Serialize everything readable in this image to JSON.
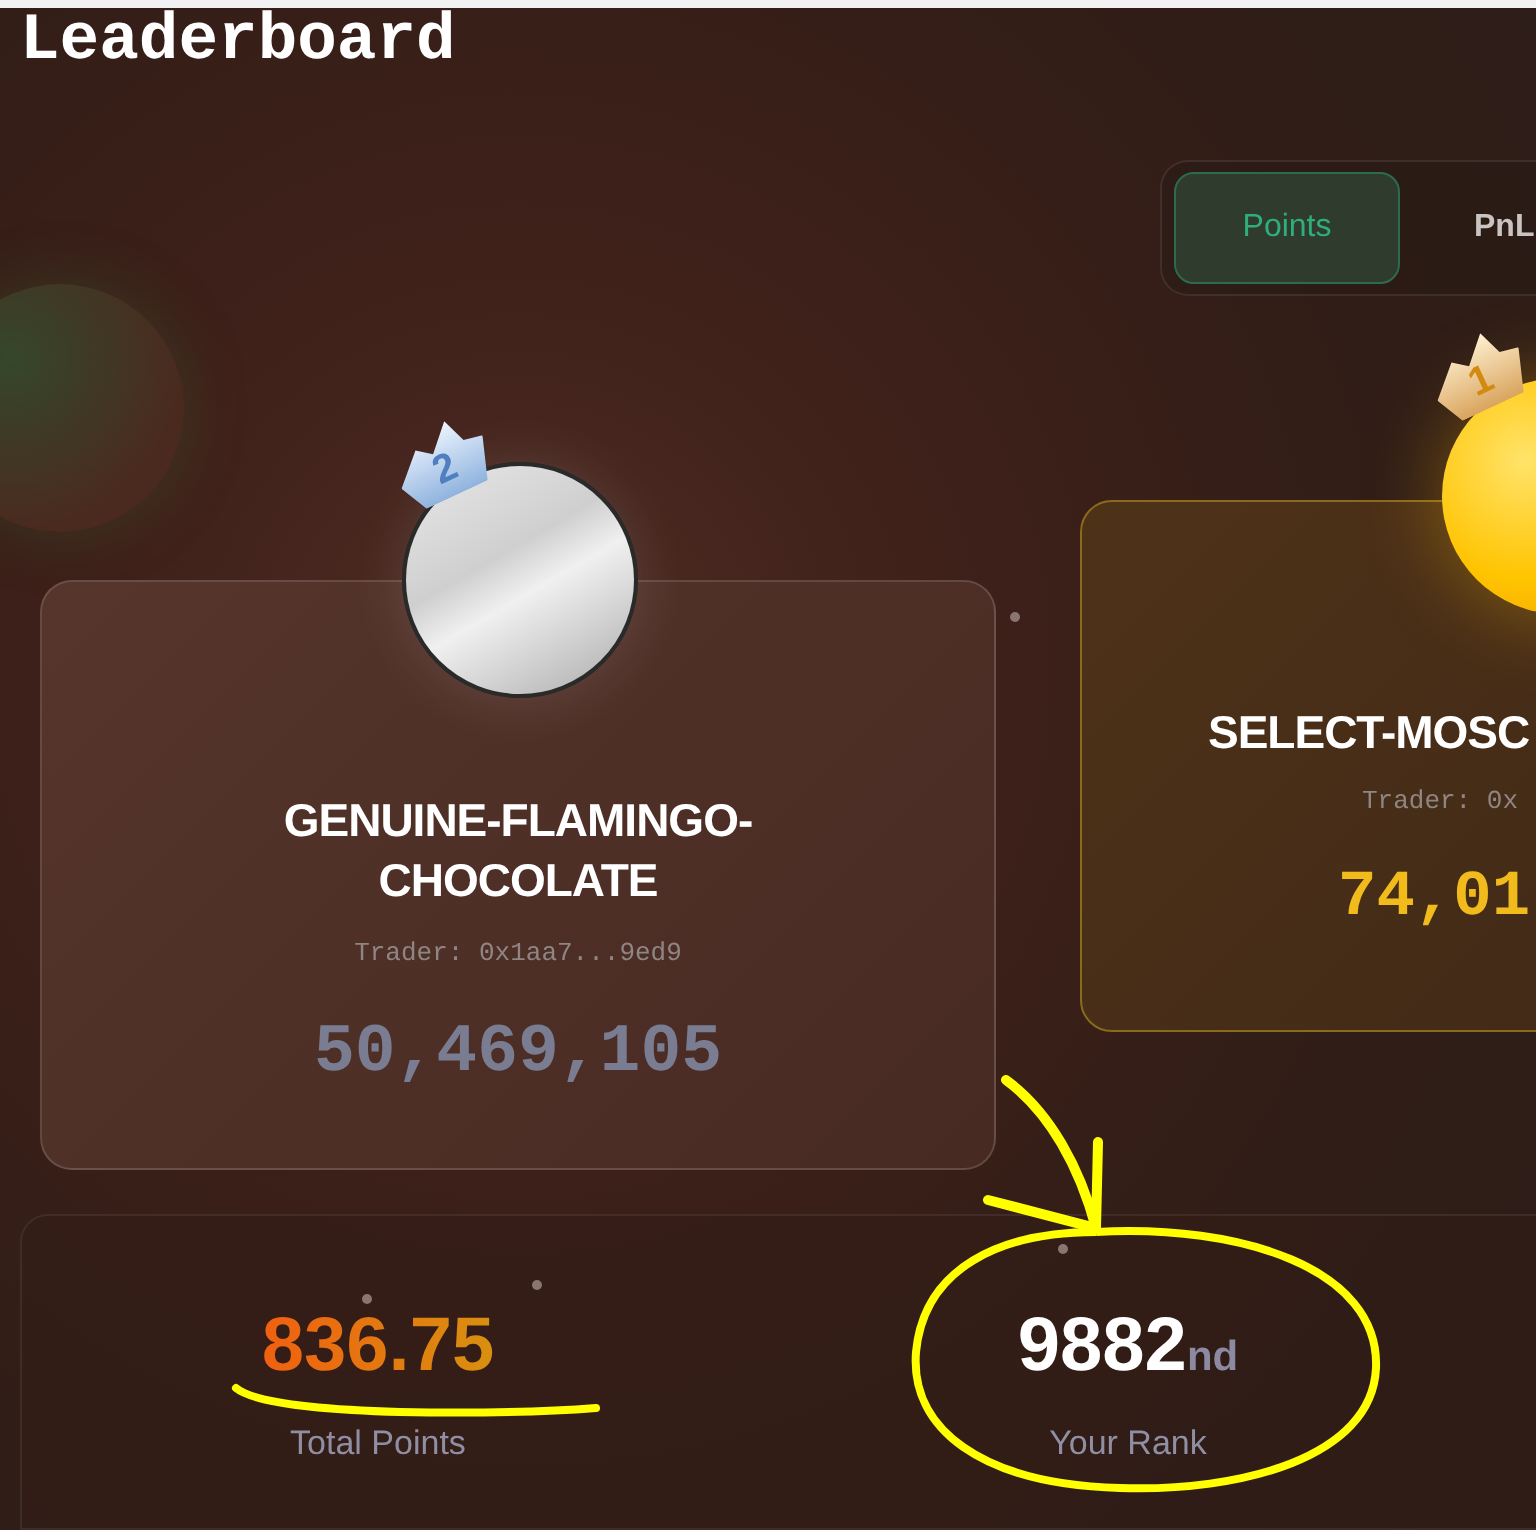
{
  "title": "Leaderboard",
  "tabs": [
    {
      "label": "Points",
      "selected": true
    },
    {
      "label": "PnL",
      "selected": false
    }
  ],
  "podium": [
    {
      "place": "2",
      "kind": "silver",
      "name": "GENUINE-FLAMINGO-CHOCOLATE",
      "trader": "Trader: 0x1aa7...9ed9",
      "value": "50,469,105"
    },
    {
      "place": "1",
      "kind": "gold",
      "name": "SELECT-MOSC",
      "trader": "Trader: 0x",
      "value": "74,01"
    }
  ],
  "stats": {
    "total_points": {
      "value": "836.75",
      "label": "Total Points"
    },
    "rank": {
      "value": "9882",
      "suffix": "nd",
      "label": "Your Rank"
    }
  }
}
